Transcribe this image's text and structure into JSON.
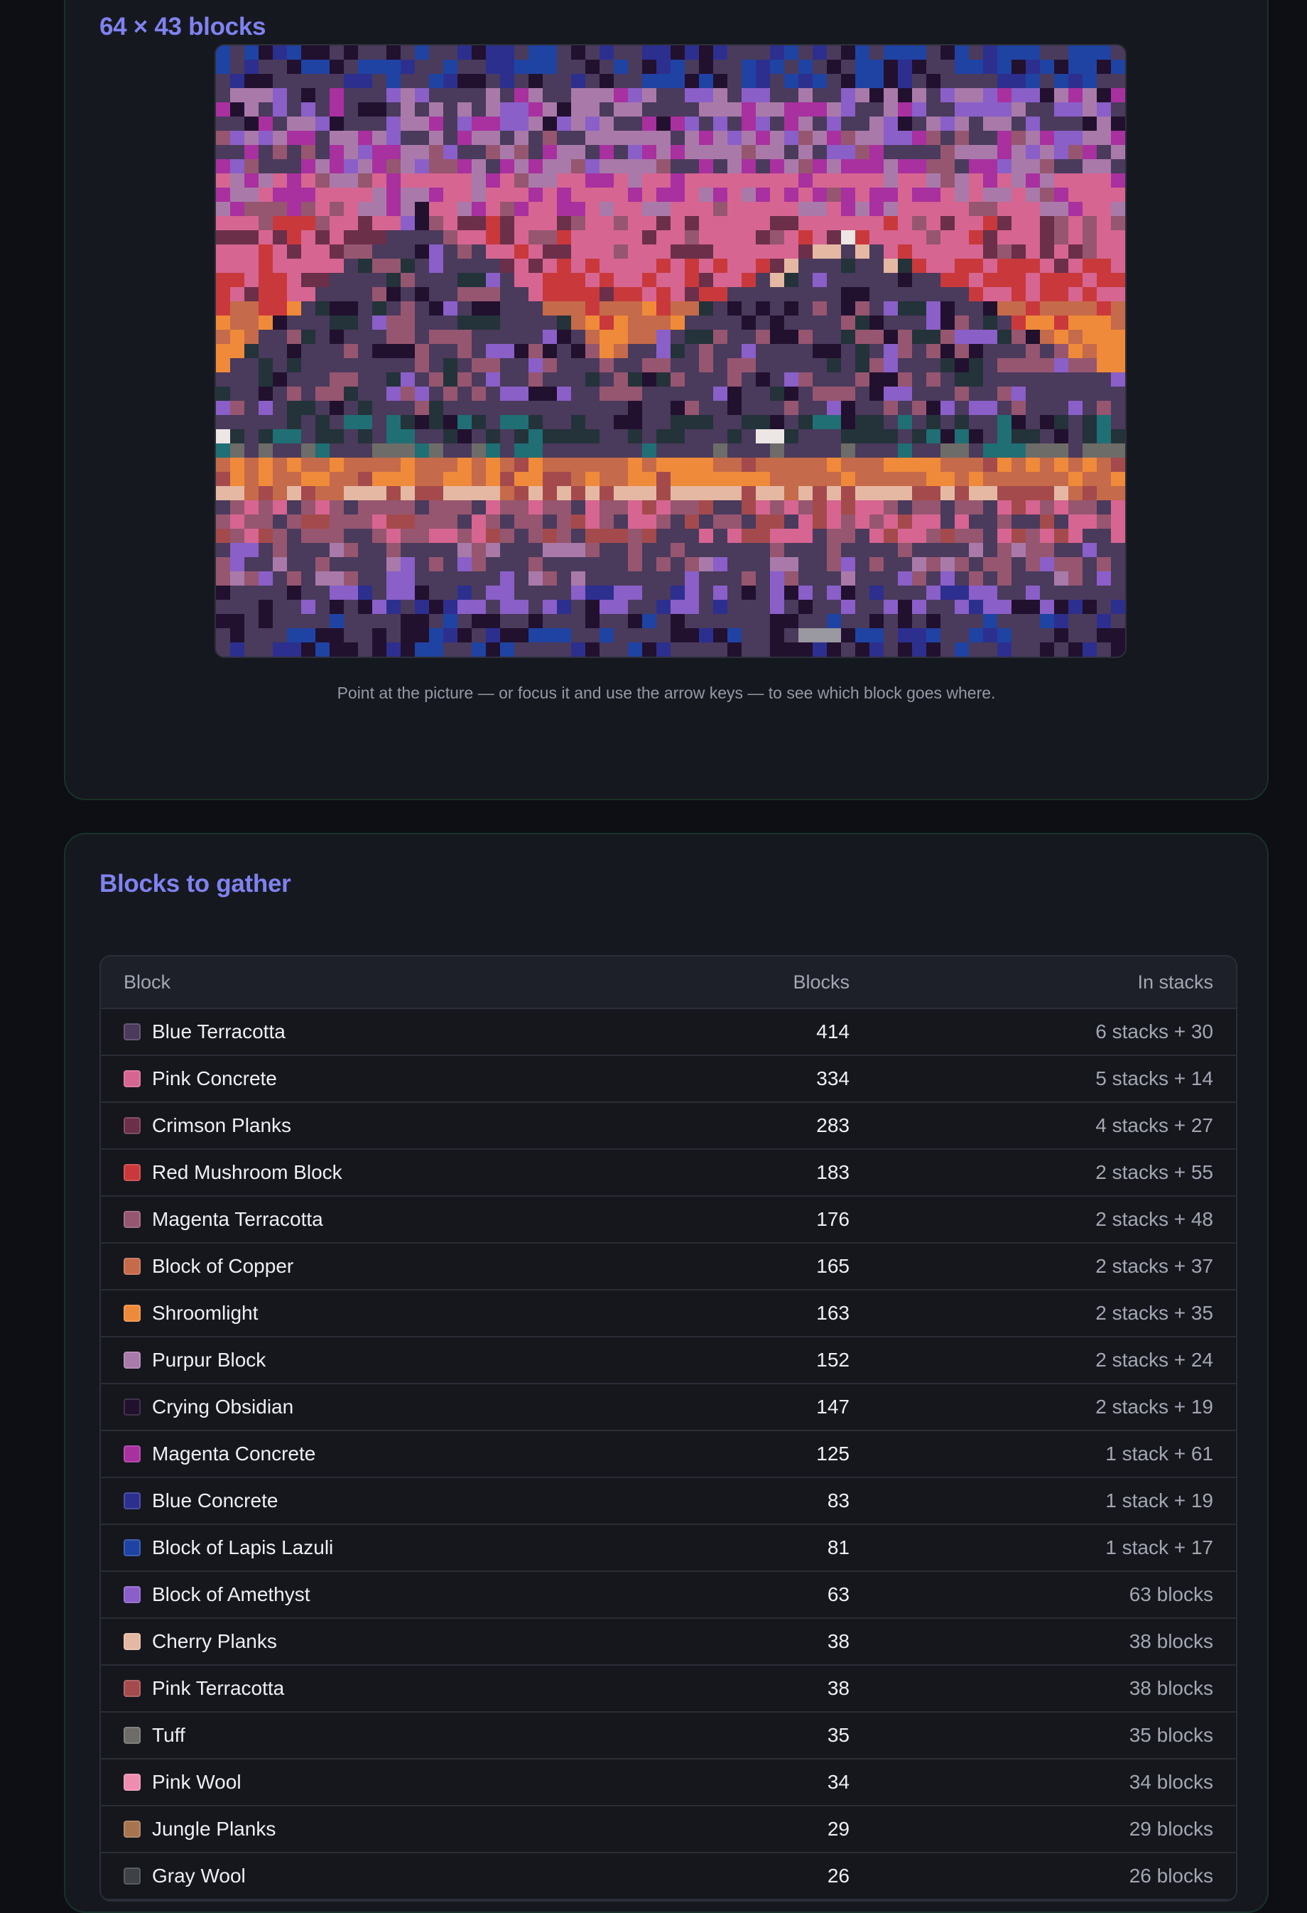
{
  "preview": {
    "title": "64 × 43 blocks",
    "hint": "Point at the picture — or focus it and use the arrow keys — to see which block goes where.",
    "mosaic_aria_label": "Block mosaic preview",
    "mosaic_columns": 64,
    "mosaic_rows": 43
  },
  "blocks_list": {
    "title": "Blocks to gather",
    "headers": {
      "block": "Block",
      "count": "Blocks",
      "stacks": "In stacks"
    },
    "rows": [
      {
        "name": "Blue Terracotta",
        "count": "414",
        "stacks": "6 stacks + 30",
        "color": "#4a3a5c"
      },
      {
        "name": "Pink Concrete",
        "count": "334",
        "stacks": "5 stacks + 14",
        "color": "#d66591"
      },
      {
        "name": "Crimson Planks",
        "count": "283",
        "stacks": "4 stacks + 27",
        "color": "#6b2f4a"
      },
      {
        "name": "Red Mushroom Block",
        "count": "183",
        "stacks": "2 stacks + 55",
        "color": "#c9393c"
      },
      {
        "name": "Magenta Terracotta",
        "count": "176",
        "stacks": "2 stacks + 48",
        "color": "#965670"
      },
      {
        "name": "Block of Copper",
        "count": "165",
        "stacks": "2 stacks + 37",
        "color": "#c56a4a"
      },
      {
        "name": "Shroomlight",
        "count": "163",
        "stacks": "2 stacks + 35",
        "color": "#ef8a3a"
      },
      {
        "name": "Purpur Block",
        "count": "152",
        "stacks": "2 stacks + 24",
        "color": "#a97aa9"
      },
      {
        "name": "Crying Obsidian",
        "count": "147",
        "stacks": "2 stacks + 19",
        "color": "#22102f"
      },
      {
        "name": "Magenta Concrete",
        "count": "125",
        "stacks": "1 stack + 61",
        "color": "#a9309f"
      },
      {
        "name": "Blue Concrete",
        "count": "83",
        "stacks": "1 stack + 19",
        "color": "#2d2f8f"
      },
      {
        "name": "Block of Lapis Lazuli",
        "count": "81",
        "stacks": "1 stack + 17",
        "color": "#1f43a3"
      },
      {
        "name": "Block of Amethyst",
        "count": "63",
        "stacks": "63 blocks",
        "color": "#8a5fc8"
      },
      {
        "name": "Cherry Planks",
        "count": "38",
        "stacks": "38 blocks",
        "color": "#e5b8a3"
      },
      {
        "name": "Pink Terracotta",
        "count": "38",
        "stacks": "38 blocks",
        "color": "#a44a4d"
      },
      {
        "name": "Tuff",
        "count": "35",
        "stacks": "35 blocks",
        "color": "#6d6c68"
      },
      {
        "name": "Pink Wool",
        "count": "34",
        "stacks": "34 blocks",
        "color": "#ee8db0"
      },
      {
        "name": "Jungle Planks",
        "count": "29",
        "stacks": "29 blocks",
        "color": "#a7744f"
      },
      {
        "name": "Gray Wool",
        "count": "26",
        "stacks": "26 blocks",
        "color": "#3e4145"
      }
    ]
  }
}
